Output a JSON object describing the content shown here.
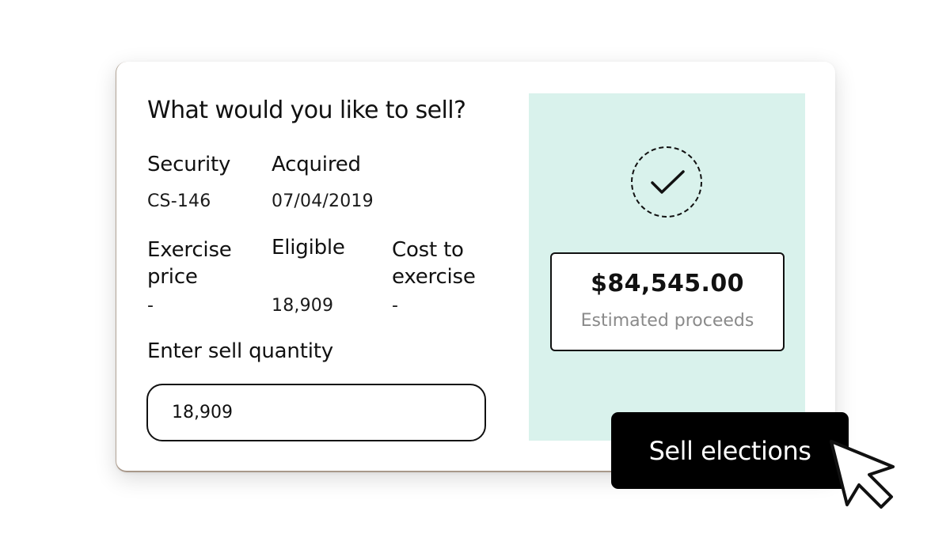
{
  "form": {
    "title": "What would you like to sell?",
    "fields": {
      "security": {
        "label": "Security",
        "value": "CS-146"
      },
      "acquired": {
        "label": "Acquired",
        "value": "07/04/2019"
      },
      "exercise_price": {
        "label": "Exercise price",
        "value": "-"
      },
      "eligible": {
        "label": "Eligible",
        "value": "18,909"
      },
      "cost_to_exercise": {
        "label": "Cost to exercise",
        "value": "-"
      }
    },
    "sell_quantity": {
      "label": "Enter sell quantity",
      "value": "18,909"
    }
  },
  "summary": {
    "status_icon": "check-icon",
    "estimated_proceeds": "$84,545.00",
    "estimated_proceeds_label": "Estimated proceeds",
    "background_color": "#d9f2ec"
  },
  "action": {
    "button_label": "Sell elections",
    "cursor_icon": "pointer-cursor-icon"
  }
}
